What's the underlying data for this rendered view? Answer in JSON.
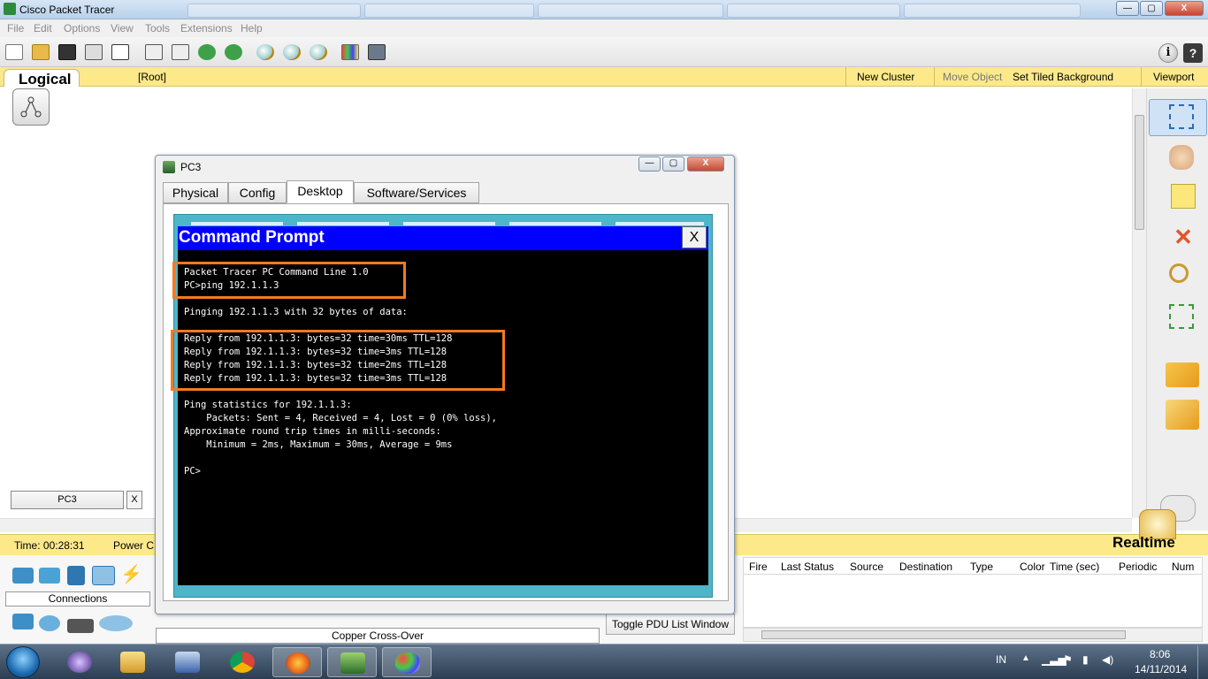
{
  "window": {
    "title": "Cisco Packet Tracer",
    "controls": {
      "minimize": "—",
      "maximize": "▢",
      "close": "X"
    }
  },
  "menu": [
    "File",
    "Edit",
    "Options",
    "View",
    "Tools",
    "Extensions",
    "Help"
  ],
  "toolbar": {
    "icons": [
      "new-icon",
      "open-icon",
      "save-icon",
      "print-icon",
      "activity-wizard-icon",
      "copy-icon",
      "paste-icon",
      "undo-icon",
      "redo-icon",
      "zoom-in-icon",
      "zoom-reset-icon",
      "zoom-out-icon",
      "palette-icon",
      "custom-device-icon"
    ],
    "info": "i",
    "help": "?"
  },
  "workspace": {
    "tab": "Logical",
    "root": "[Root]",
    "new_cluster": "New Cluster",
    "move_object": "Move Object",
    "set_tiled_background": "Set Tiled Background",
    "viewport": "Viewport"
  },
  "canvas": {
    "window_tab": "PC3",
    "window_tab_close": "X"
  },
  "right_palette": [
    "select-icon",
    "hand-icon",
    "note-icon",
    "delete-icon",
    "inspect-icon",
    "resize-shape-icon",
    "add-simple-pdu-icon",
    "add-complex-pdu-icon"
  ],
  "status": {
    "time": "Time: 00:28:31",
    "power": "Power C",
    "mode": "Realtime"
  },
  "device_panel": {
    "category_label": "Connections",
    "selected_cable": "Copper Cross-Over"
  },
  "pdu": {
    "toggle": "Toggle PDU List Window",
    "columns": [
      "Fire",
      "Last Status",
      "Source",
      "Destination",
      "Type",
      "Color",
      "Time (sec)",
      "Periodic",
      "Num"
    ]
  },
  "dialog": {
    "title": "PC3",
    "tabs": [
      "Physical",
      "Config",
      "Desktop",
      "Software/Services"
    ],
    "active_tab": "Desktop",
    "controls": {
      "minimize": "—",
      "maximize": "▢",
      "close": "X"
    },
    "command_prompt": {
      "title": "Command Prompt",
      "close": "X",
      "lines": [
        "Packet Tracer PC Command Line 1.0",
        "PC>ping 192.1.1.3",
        "",
        "Pinging 192.1.1.3 with 32 bytes of data:",
        "",
        "Reply from 192.1.1.3: bytes=32 time=30ms TTL=128",
        "Reply from 192.1.1.3: bytes=32 time=3ms TTL=128",
        "Reply from 192.1.1.3: bytes=32 time=2ms TTL=128",
        "Reply from 192.1.1.3: bytes=32 time=3ms TTL=128",
        "",
        "Ping statistics for 192.1.1.3:",
        "    Packets: Sent = 4, Received = 4, Lost = 0 (0% loss),",
        "Approximate round trip times in milli-seconds:",
        "    Minimum = 2ms, Maximum = 30ms, Average = 9ms",
        "",
        "PC>"
      ]
    }
  },
  "taskbar": {
    "apps": [
      "eclipse-icon",
      "file-explorer-icon",
      "network-icon",
      "chrome-icon",
      "firefox-icon",
      "packet-tracer-icon",
      "paint-icon"
    ],
    "lang": "IN",
    "time": "8:06",
    "date": "14/11/2014"
  },
  "colors": {
    "workspace_bar": "#fde98a",
    "cmd_title": "#0000ff",
    "cmd_frame": "#4db6c9",
    "highlight": "#f47a20"
  }
}
